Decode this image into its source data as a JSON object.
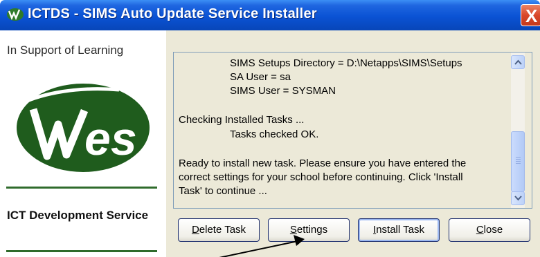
{
  "window": {
    "title": "ICTDS - SIMS Auto Update Service Installer",
    "close_glyph": "X",
    "title_icon": "wes-logo-icon"
  },
  "sidebar": {
    "support_text": "In Support of Learning",
    "logo_text": "Wes",
    "service_text": "ICT Development Service"
  },
  "log": {
    "lines": [
      "SIMS Setups Directory = D:\\Netapps\\SIMS\\Setups",
      "SA User = sa",
      "SIMS User = SYSMAN",
      "Checking Installed Tasks ...",
      "Tasks checked OK.",
      "Ready to install new task. Please ensure you have entered the",
      "correct settings for your school before continuing. Click 'Install",
      "Task' to continue ..."
    ]
  },
  "buttons": {
    "delete": {
      "mnemonic": "D",
      "rest": "elete Task"
    },
    "settings": {
      "mnemonic": "S",
      "rest": "ettings"
    },
    "install": {
      "mnemonic": "I",
      "rest": "nstall Task"
    },
    "close": {
      "mnemonic": "C",
      "rest": "lose"
    }
  },
  "colors": {
    "titlebar": "#0a52d4",
    "logo_green": "#1f5c1d",
    "rule_green": "#2f6b2c",
    "dialog_bg": "#ece9d8"
  }
}
